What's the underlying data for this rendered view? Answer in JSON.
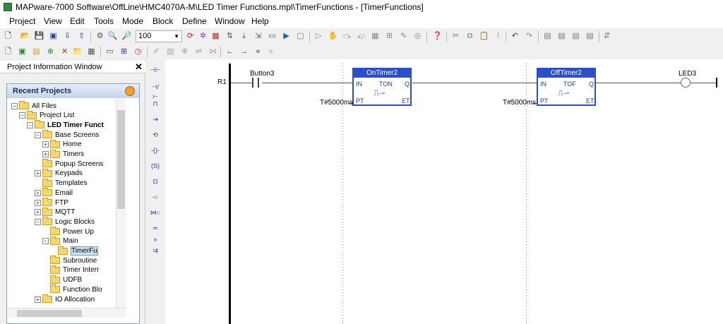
{
  "window": {
    "title": "MAPware-7000 Software\\OffLine\\HMC4070A-M\\LED Timer Functions.mpl\\TimerFunctions - [TimerFunctions]"
  },
  "menu": [
    "Project",
    "View",
    "Edit",
    "Tools",
    "Mode",
    "Block",
    "Define",
    "Window",
    "Help"
  ],
  "toolbar": {
    "zoom_value": "100"
  },
  "project_window": {
    "title": "Project Information Window",
    "close": "✕",
    "recent_projects": "Recent Projects",
    "tree": [
      {
        "label": "All Files",
        "depth": 0,
        "exp": "−",
        "bold": false
      },
      {
        "label": "Project List",
        "depth": 1,
        "exp": "−",
        "bold": false
      },
      {
        "label": "LED Timer Funct",
        "depth": 2,
        "exp": "−",
        "bold": true
      },
      {
        "label": "Base Screens",
        "depth": 3,
        "exp": "−",
        "bold": false
      },
      {
        "label": "Home",
        "depth": 4,
        "exp": "+",
        "bold": false
      },
      {
        "label": "Timers",
        "depth": 4,
        "exp": "+",
        "bold": false
      },
      {
        "label": "Popup Screens",
        "depth": 3,
        "exp": "",
        "bold": false
      },
      {
        "label": "Keypads",
        "depth": 3,
        "exp": "+",
        "bold": false
      },
      {
        "label": "Templates",
        "depth": 3,
        "exp": "",
        "bold": false
      },
      {
        "label": "Email",
        "depth": 3,
        "exp": "+",
        "bold": false
      },
      {
        "label": "FTP",
        "depth": 3,
        "exp": "+",
        "bold": false
      },
      {
        "label": "MQTT",
        "depth": 3,
        "exp": "+",
        "bold": false
      },
      {
        "label": "Logic Blocks",
        "depth": 3,
        "exp": "−",
        "bold": false
      },
      {
        "label": "Power Up",
        "depth": 4,
        "exp": "",
        "bold": false
      },
      {
        "label": "Main",
        "depth": 4,
        "exp": "−",
        "bold": false
      },
      {
        "label": "TimerFu",
        "depth": 5,
        "exp": "",
        "bold": false,
        "selected": true
      },
      {
        "label": "Subroutine",
        "depth": 4,
        "exp": "",
        "bold": false
      },
      {
        "label": "Timer Interr",
        "depth": 4,
        "exp": "",
        "bold": false
      },
      {
        "label": "UDFB",
        "depth": 4,
        "exp": "",
        "bold": false
      },
      {
        "label": "Function Blo",
        "depth": 4,
        "exp": "",
        "bold": false
      },
      {
        "label": "IO Allocation",
        "depth": 3,
        "exp": "+",
        "bold": false
      }
    ]
  },
  "ladder": {
    "rung_label": "R1",
    "contact_label": "Button3",
    "coil_label": "LED3",
    "blocks": [
      {
        "name": "OnTimer2",
        "type": "TON",
        "in": "IN",
        "q": "Q",
        "pt": "PT",
        "et": "ET",
        "preset": "T#5000ms"
      },
      {
        "name": "OffTimer2",
        "type": "TOF",
        "in": "IN",
        "q": "Q",
        "pt": "PT",
        "et": "ET",
        "preset": "T#5000ms"
      }
    ]
  },
  "colors": {
    "block_border": "#2c4fc9",
    "block_header": "#2c4fc9"
  }
}
